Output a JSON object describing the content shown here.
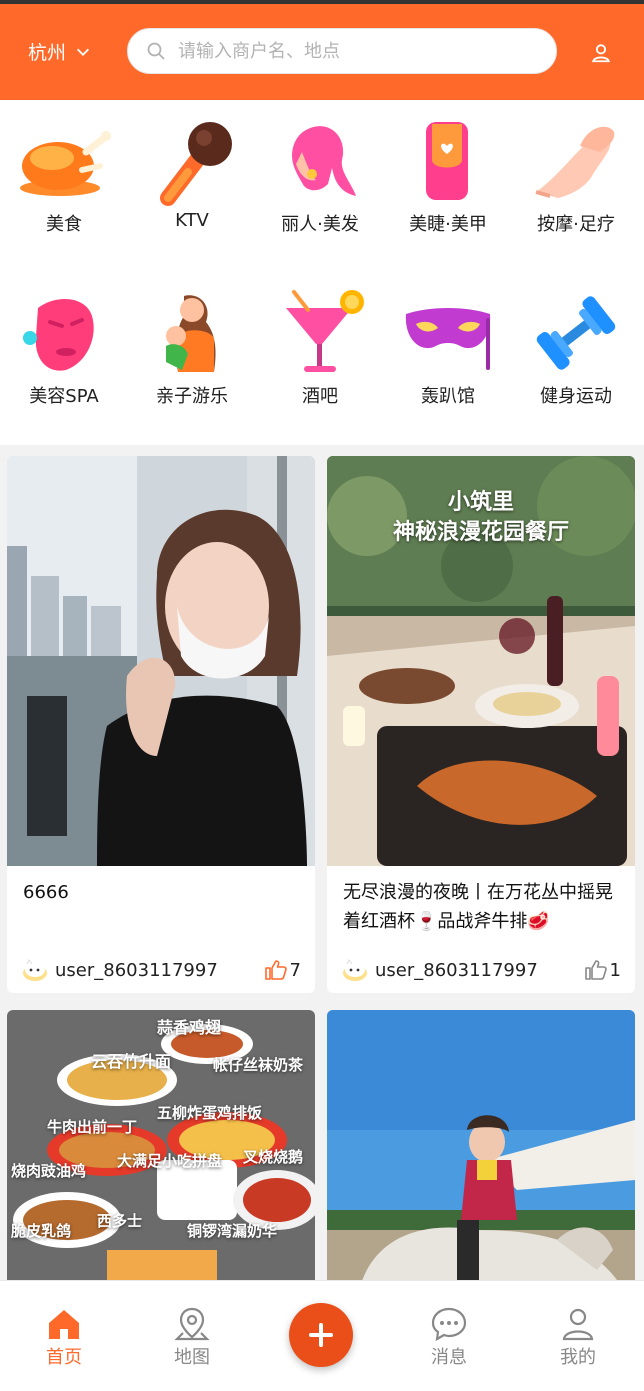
{
  "header": {
    "city": "杭州",
    "search_placeholder": "请输入商户名、地点"
  },
  "categories": [
    {
      "label": "美食",
      "icon": "roast-chicken-icon"
    },
    {
      "label": "KTV",
      "icon": "microphone-icon"
    },
    {
      "label": "丽人·美发",
      "icon": "hair-salon-icon"
    },
    {
      "label": "美睫·美甲",
      "icon": "nail-icon"
    },
    {
      "label": "按摩·足疗",
      "icon": "massage-hand-icon"
    },
    {
      "label": "美容SPA",
      "icon": "face-mask-icon"
    },
    {
      "label": "亲子游乐",
      "icon": "parent-child-icon"
    },
    {
      "label": "酒吧",
      "icon": "cocktail-icon"
    },
    {
      "label": "轰趴馆",
      "icon": "party-mask-icon"
    },
    {
      "label": "健身运动",
      "icon": "dumbbell-icon"
    }
  ],
  "feed": [
    {
      "title": "6666",
      "author": "user_8603117997",
      "likes": "7",
      "liked": true
    },
    {
      "title": "无尽浪漫的夜晚丨在万花丛中摇晃着红酒杯🍷品战斧牛排🥩",
      "author": "user_8603117997",
      "likes": "1",
      "liked": false,
      "image_text": [
        "小筑里",
        "神秘浪漫花园餐厅"
      ]
    },
    {
      "image_text": [
        "蒜香鸡翅",
        "云吞竹升面",
        "帐仔丝袜奶茶",
        "牛肉出前一丁",
        "五柳炸蛋鸡排饭",
        "烧肉豉油鸡",
        "大满足小吃拼盘",
        "叉烧烧鹅",
        "脆皮乳鸽",
        "西多士",
        "铜锣湾漏奶华"
      ]
    },
    {}
  ],
  "tabbar": {
    "items": [
      {
        "label": "首页",
        "icon": "home-icon",
        "active": true
      },
      {
        "label": "地图",
        "icon": "map-pin-icon",
        "active": false
      },
      {
        "label": "消息",
        "icon": "message-icon",
        "active": false
      },
      {
        "label": "我的",
        "icon": "profile-icon",
        "active": false
      }
    ],
    "fab_icon": "plus-icon"
  },
  "colors": {
    "brand": "#ff6a2b",
    "fab": "#ea4f1a"
  }
}
